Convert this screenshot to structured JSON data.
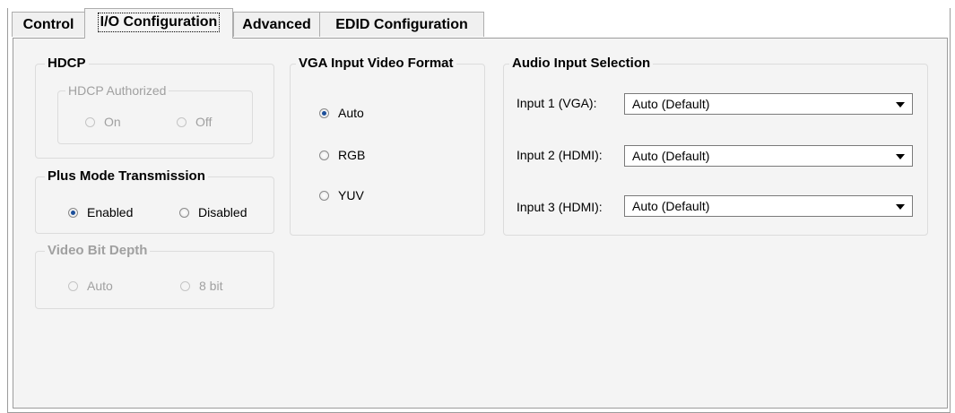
{
  "tabs": [
    {
      "label": "Control"
    },
    {
      "label": "I/O Configuration"
    },
    {
      "label": "Advanced"
    },
    {
      "label": "EDID Configuration"
    }
  ],
  "hdcp": {
    "title": "HDCP",
    "authorized_title": "HDCP Authorized",
    "on_label": "On",
    "off_label": "Off"
  },
  "plus_mode": {
    "title": "Plus Mode Transmission",
    "enabled_label": "Enabled",
    "disabled_label": "Disabled",
    "selected": "Enabled"
  },
  "video_bit_depth": {
    "title": "Video Bit Depth",
    "auto_label": "Auto",
    "bit8_label": "8 bit"
  },
  "vga_format": {
    "title": "VGA Input Video Format",
    "options": [
      "Auto",
      "RGB",
      "YUV"
    ],
    "selected": "Auto"
  },
  "audio": {
    "title": "Audio Input Selection",
    "inputs": [
      {
        "label": "Input 1 (VGA):",
        "value": "Auto (Default)"
      },
      {
        "label": "Input 2 (HDMI):",
        "value": "Auto (Default)"
      },
      {
        "label": "Input 3 (HDMI):",
        "value": "Auto (Default)"
      }
    ]
  },
  "colors": {
    "radio_selected": "#1c4f9a",
    "panel_bg": "#f4f4f4",
    "disabled_text": "#a0a0a0"
  }
}
